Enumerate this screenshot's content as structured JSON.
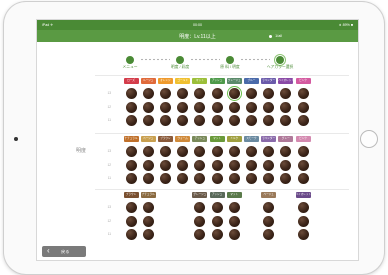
{
  "device": {
    "home_button": "home-button",
    "camera": "front-camera"
  },
  "status_bar": {
    "left": "iPad ✈",
    "time": "00:00",
    "right": "∗ 89% ■"
  },
  "title_bar": {
    "title": "明度：Lv.11以上",
    "subtitle": "1/all"
  },
  "steps": [
    {
      "label": "メニュー",
      "active": false
    },
    {
      "label": "明度 / 彩度",
      "active": false
    },
    {
      "label": "原 料 / 明度",
      "active": false
    },
    {
      "label": "ヘアカラー選択",
      "active": true
    }
  ],
  "side_label": "明度",
  "groups": [
    {
      "tags": [
        {
          "label": "ローズ",
          "color": "#d43c4a"
        },
        {
          "label": "ルージュ",
          "color": "#e06a3a"
        },
        {
          "label": "オレンジ",
          "color": "#ef9a2c"
        },
        {
          "label": "ゴールド",
          "color": "#f0c030"
        },
        {
          "label": "マット",
          "color": "#9cbf3a"
        },
        {
          "label": "アッシュ",
          "color": "#4e9a4a"
        },
        {
          "label": "グレージュ",
          "color": "#5a8a6a"
        },
        {
          "label": "ブルー",
          "color": "#4a6aaa"
        },
        {
          "label": "ラベンダー",
          "color": "#6a5aaa"
        },
        {
          "label": "バイオレット",
          "color": "#8a4aa6"
        },
        {
          "label": "ピンク",
          "color": "#d45aa0"
        }
      ],
      "rows": [
        {
          "level": "13",
          "count": 11
        },
        {
          "level": "12",
          "count": 11
        },
        {
          "level": "11",
          "count": 11
        }
      ]
    },
    {
      "tags": [
        {
          "label": "ナチュラル",
          "color": "#c0702a"
        },
        {
          "label": "ベージュ",
          "color": "#c9a050"
        },
        {
          "label": "ブラウン",
          "color": "#8a5a3a"
        },
        {
          "label": "ウォーム",
          "color": "#d08a3a"
        },
        {
          "label": "アッシュ",
          "color": "#7a8a5a"
        },
        {
          "label": "マット",
          "color": "#6a9a3a"
        },
        {
          "label": "ミルク",
          "color": "#a0a040"
        },
        {
          "label": "スモーク",
          "color": "#6a8aa0"
        },
        {
          "label": "ラベンダー",
          "color": "#8a6aaa"
        },
        {
          "label": "グレー",
          "color": "#b07a9a"
        },
        {
          "label": "ピンク",
          "color": "#d48ab0"
        }
      ],
      "rows": [
        {
          "level": "13",
          "count": 11
        },
        {
          "level": "12",
          "count": 11
        },
        {
          "level": "11",
          "count": 11
        }
      ]
    },
    {
      "tags": [
        {
          "label": "ブラウン",
          "color": "#7a5030"
        },
        {
          "label": "ナチュラル",
          "color": "#8a6a40"
        },
        {
          "label": "",
          "color": ""
        },
        {
          "label": "",
          "color": ""
        },
        {
          "label": "グレージュ",
          "color": "#6a5a4a"
        },
        {
          "label": "アッシュ",
          "color": "#5a6a5a"
        },
        {
          "label": "マット",
          "color": "#5a7a4a"
        },
        {
          "label": "",
          "color": ""
        },
        {
          "label": "ベージュ",
          "color": "#9a7a5a"
        },
        {
          "label": "",
          "color": ""
        },
        {
          "label": "バイオレット",
          "color": "#6a4a8a"
        }
      ],
      "rows": [
        {
          "level": "13",
          "count": 11
        },
        {
          "level": "12",
          "count": 11
        },
        {
          "level": "11",
          "count": 11
        }
      ],
      "present_columns": [
        0,
        1,
        4,
        5,
        6,
        8,
        10
      ]
    }
  ],
  "selected_swatch": {
    "group": 0,
    "row": 0,
    "column": 6
  },
  "back_button": {
    "label": "戻る",
    "icon": "chevron-left-icon"
  },
  "colors": {
    "accent": "#4a8a35",
    "titlebar": "#5a9a43",
    "swatch": "#3b2418"
  }
}
